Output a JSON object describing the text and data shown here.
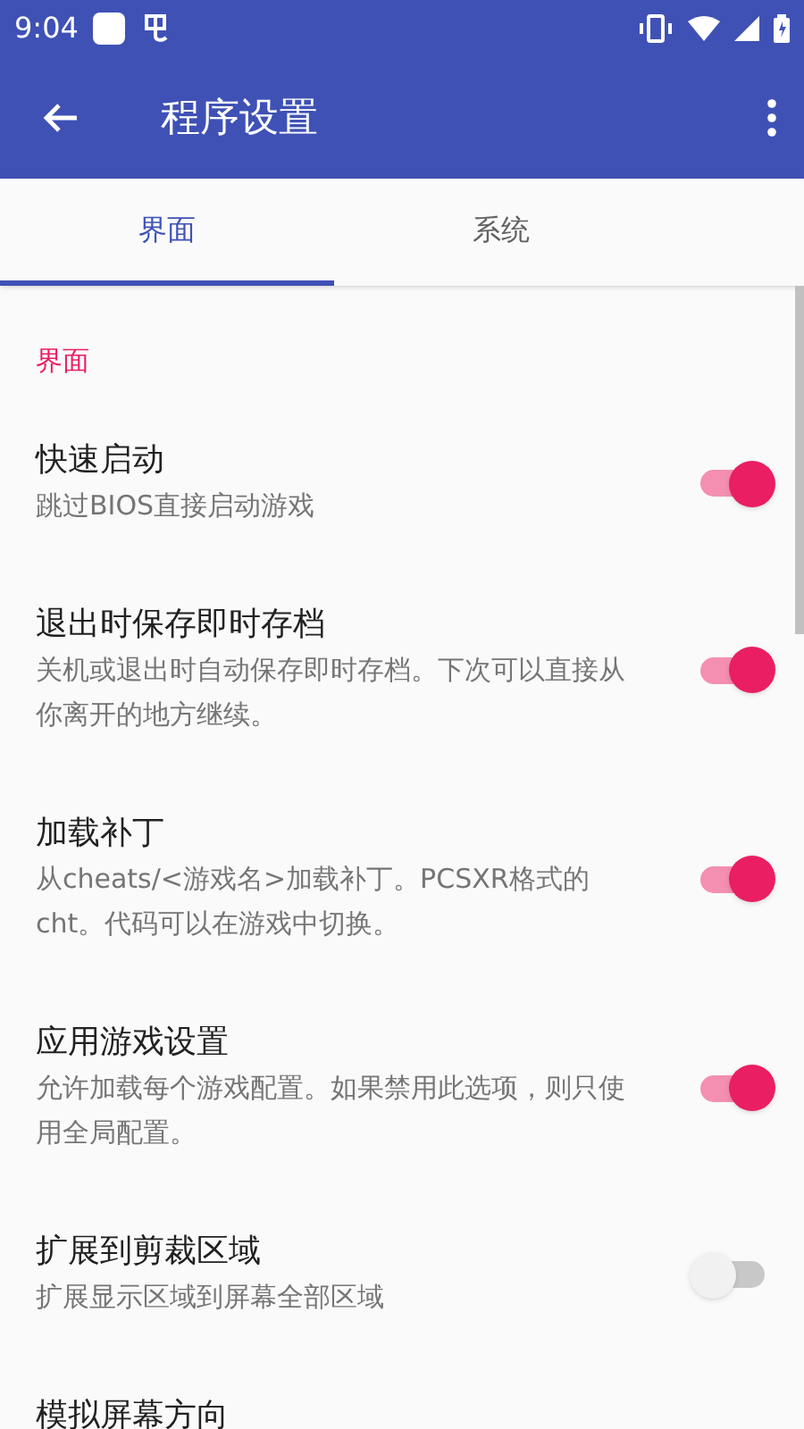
{
  "status_bar": {
    "time": "9:04"
  },
  "app_bar": {
    "title": "程序设置"
  },
  "tabs": [
    {
      "label": "界面",
      "selected": true
    },
    {
      "label": "系统",
      "selected": false
    }
  ],
  "section": {
    "title": "界面"
  },
  "settings": [
    {
      "title": "快速启动",
      "summary": "跳过BIOS直接启动游戏",
      "on": true
    },
    {
      "title": "退出时保存即时存档",
      "summary": "关机或退出时自动保存即时存档。下次可以直接从你离开的地方继续。",
      "on": true
    },
    {
      "title": "加载补丁",
      "summary": "从cheats/<游戏名>加载补丁。PCSXR格式的cht。代码可以在游戏中切换。",
      "on": true
    },
    {
      "title": "应用游戏设置",
      "summary": "允许加载每个游戏配置。如果禁用此选项，则只使用全局配置。",
      "on": true
    },
    {
      "title": "扩展到剪裁区域",
      "summary": "扩展显示区域到屏幕全部区域",
      "on": false
    },
    {
      "title": "模拟屏幕方向"
    }
  ]
}
